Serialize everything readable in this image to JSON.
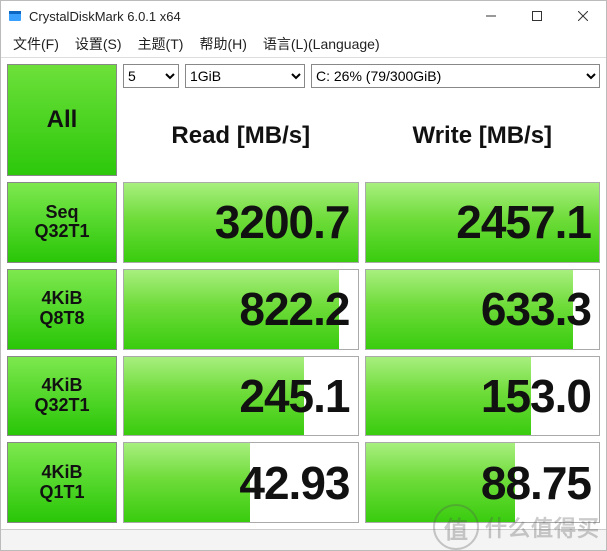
{
  "window": {
    "title": "CrystalDiskMark 6.0.1 x64"
  },
  "menu": {
    "file": "文件(F)",
    "settings": "设置(S)",
    "theme": "主题(T)",
    "help": "帮助(H)",
    "language": "语言(L)(Language)"
  },
  "controls": {
    "all_label": "All",
    "runs_value": "5",
    "size_value": "1GiB",
    "drive_value": "C: 26% (79/300GiB)"
  },
  "headers": {
    "read": "Read [MB/s]",
    "write": "Write [MB/s]"
  },
  "tests": [
    {
      "label1": "Seq",
      "label2": "Q32T1",
      "read": "3200.7",
      "read_pct": 100,
      "write": "2457.1",
      "write_pct": 100
    },
    {
      "label1": "4KiB",
      "label2": "Q8T8",
      "read": "822.2",
      "read_pct": 92,
      "write": "633.3",
      "write_pct": 89
    },
    {
      "label1": "4KiB",
      "label2": "Q32T1",
      "read": "245.1",
      "read_pct": 77,
      "write": "153.0",
      "write_pct": 71
    },
    {
      "label1": "4KiB",
      "label2": "Q1T1",
      "read": "42.93",
      "read_pct": 54,
      "write": "88.75",
      "write_pct": 64
    }
  ],
  "watermark": {
    "badge": "值",
    "text": "什么值得买"
  },
  "chart_data": {
    "type": "table",
    "title": "CrystalDiskMark 6.0.1 x64",
    "drive": "C: 26% (79/300GiB)",
    "runs": 5,
    "test_size": "1GiB",
    "unit": "MB/s",
    "columns": [
      "Test",
      "Read",
      "Write"
    ],
    "rows": [
      {
        "Test": "Seq Q32T1",
        "Read": 3200.7,
        "Write": 2457.1
      },
      {
        "Test": "4KiB Q8T8",
        "Read": 822.2,
        "Write": 633.3
      },
      {
        "Test": "4KiB Q32T1",
        "Read": 245.1,
        "Write": 153.0
      },
      {
        "Test": "4KiB Q1T1",
        "Read": 42.93,
        "Write": 88.75
      }
    ]
  }
}
